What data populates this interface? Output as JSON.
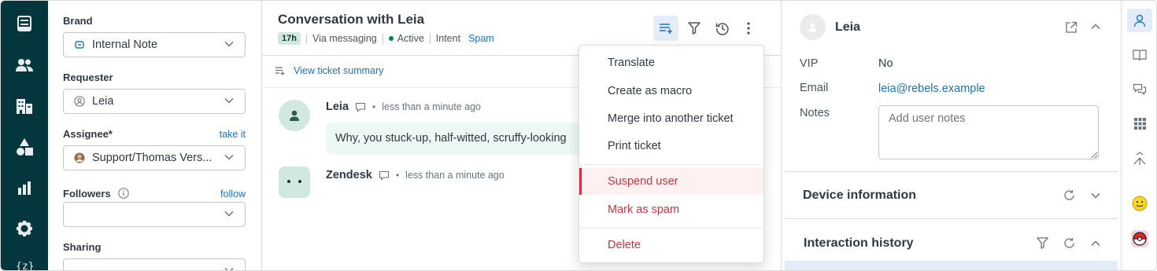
{
  "nav": {
    "items": [
      "views-icon",
      "users-icon",
      "organizations-icon",
      "objects-icon",
      "reporting-icon",
      "settings-icon"
    ],
    "footer_label": "{z}"
  },
  "properties": {
    "brand": {
      "label": "Brand",
      "value": "Internal Note"
    },
    "requester": {
      "label": "Requester",
      "value": "Leia"
    },
    "assignee": {
      "label": "Assignee*",
      "link": "take it",
      "value": "Support/Thomas Vers..."
    },
    "followers": {
      "label": "Followers",
      "link": "follow",
      "value": ""
    },
    "sharing": {
      "label": "Sharing"
    }
  },
  "conversation": {
    "title": "Conversation with Leia",
    "age_badge": "17h",
    "channel": "Via messaging",
    "status": "Active",
    "intent_label": "Intent",
    "intent_value": "Spam",
    "summary_link": "View ticket summary",
    "messages": [
      {
        "author": "Leia",
        "time": "less than a minute ago",
        "text": "Why, you stuck-up, half-witted, scruffy-looking"
      },
      {
        "author": "Zendesk",
        "time": "less than a minute ago",
        "text": ""
      }
    ]
  },
  "menu": {
    "items": [
      "Translate",
      "Create as macro",
      "Merge into another ticket",
      "Print ticket"
    ],
    "danger_items": [
      "Suspend user",
      "Mark as spam"
    ],
    "delete": "Delete"
  },
  "user": {
    "name": "Leia",
    "vip_label": "VIP",
    "vip_value": "No",
    "email_label": "Email",
    "email_value": "leia@rebels.example",
    "notes_label": "Notes",
    "notes_placeholder": "Add user notes",
    "device_section": "Device information",
    "history_section": "Interaction history"
  },
  "colors": {
    "nav_bg": "#03363d",
    "accent": "#1f73b7",
    "danger": "#cc3340",
    "status_active": "#038153"
  }
}
